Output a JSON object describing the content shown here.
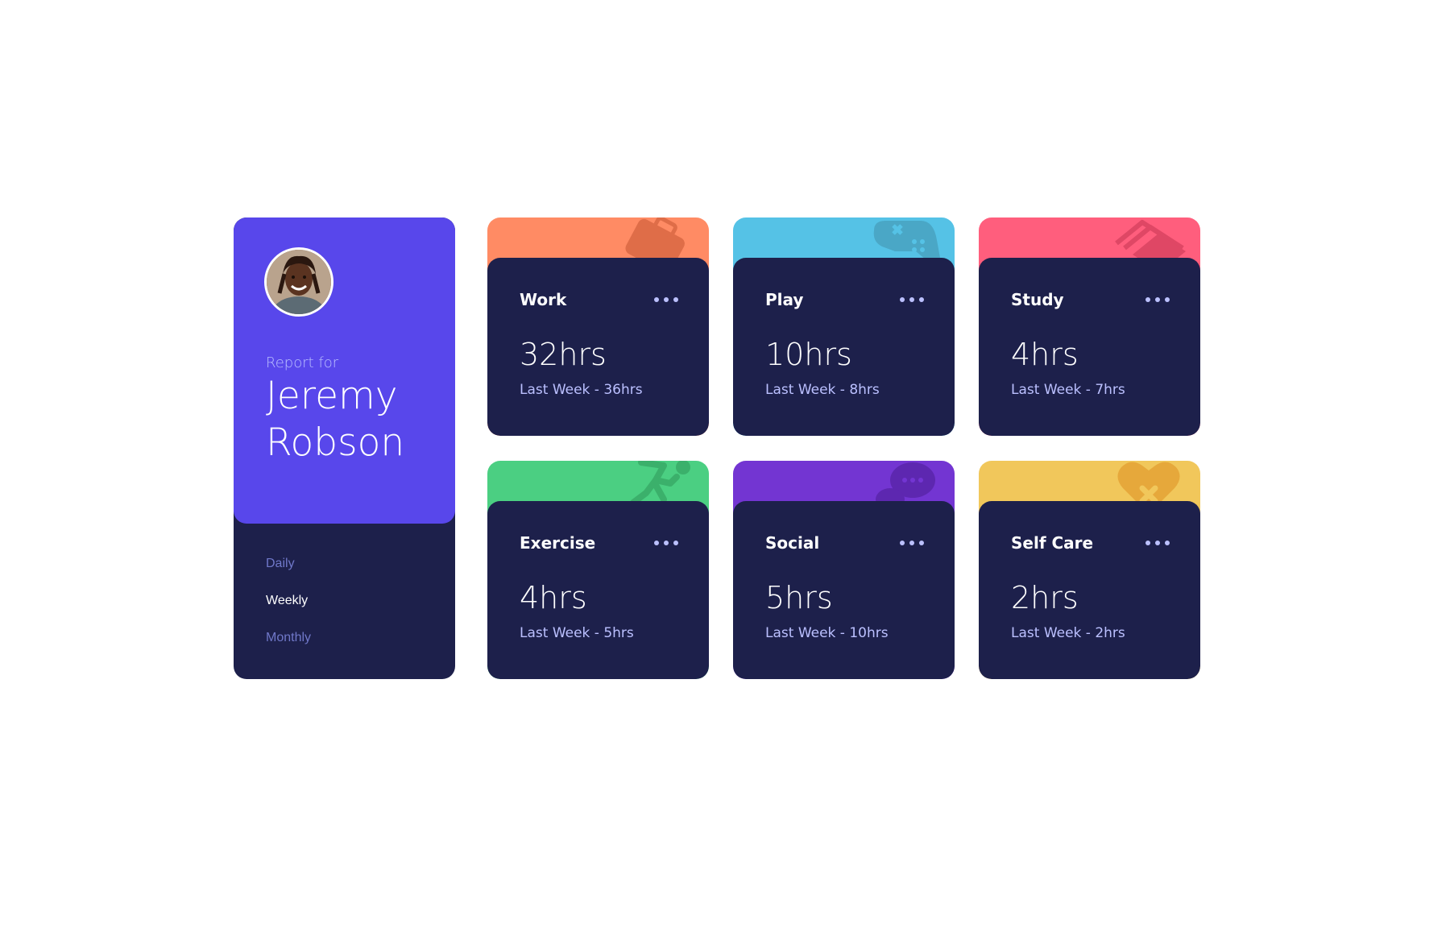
{
  "profile": {
    "report_for": "Report for",
    "first_name": "Jeremy",
    "last_name": "Robson",
    "periods": [
      "Daily",
      "Weekly",
      "Monthly"
    ],
    "active_period": "Weekly"
  },
  "cards": [
    {
      "title": "Work",
      "current": "32hrs",
      "previous": "Last Week - 36hrs",
      "color": "#ff8b64",
      "icon": "briefcase-icon"
    },
    {
      "title": "Play",
      "current": "10hrs",
      "previous": "Last Week - 8hrs",
      "color": "#55c2e6",
      "icon": "gamepad-icon"
    },
    {
      "title": "Study",
      "current": "4hrs",
      "previous": "Last Week - 7hrs",
      "color": "#ff5e7d",
      "icon": "books-icon"
    },
    {
      "title": "Exercise",
      "current": "4hrs",
      "previous": "Last Week - 5hrs",
      "color": "#4bcf82",
      "icon": "runner-icon"
    },
    {
      "title": "Social",
      "current": "5hrs",
      "previous": "Last Week - 10hrs",
      "color": "#7335d2",
      "icon": "chat-icon"
    },
    {
      "title": "Self Care",
      "current": "2hrs",
      "previous": "Last Week - 2hrs",
      "color": "#f1c75b",
      "icon": "heart-bandage-icon"
    }
  ],
  "colors": {
    "profile_accent": "#5847eb",
    "card_body": "#1d204b",
    "muted_text": "#bbc0ff",
    "inactive_period": "#7078c9"
  }
}
